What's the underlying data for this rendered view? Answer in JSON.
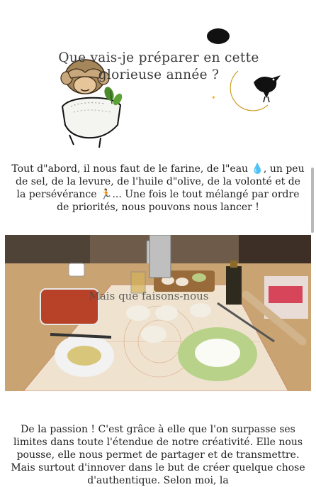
{
  "header": {
    "title": "Que vais-je préparer en cette glorieuse année ?"
  },
  "intro": {
    "text": "Tout d\"abord, il nous faut de le farine, de l\"eau 💧, un peu de sel, de la levure, de l'huile d\"olive, de la volonté et de la persévérance 🏃... Une fois le tout mélangé par ordre de priorités, nous pouvons nous lancer !"
  },
  "photo": {
    "caption": "Mais que faisons-nous"
  },
  "passion": {
    "text": "De la passion ! C'est grâce à elle que l'on surpasse ses limites dans toute l'étendue de notre créativité. Elle nous pousse, elle nous permet de partager et de transmettre. Mais surtout d'innover dans le but de créer quelque chose d'authentique. Selon moi, la"
  },
  "colors": {
    "moon": "#f2b705",
    "crow": "#111111",
    "table": "#c9a472",
    "background": "#ffffff"
  },
  "icons": [
    "monkey-covering-eyes",
    "flour-bowl-with-plant",
    "crescent-moon-icon",
    "crow-icon",
    "ink-blob"
  ]
}
